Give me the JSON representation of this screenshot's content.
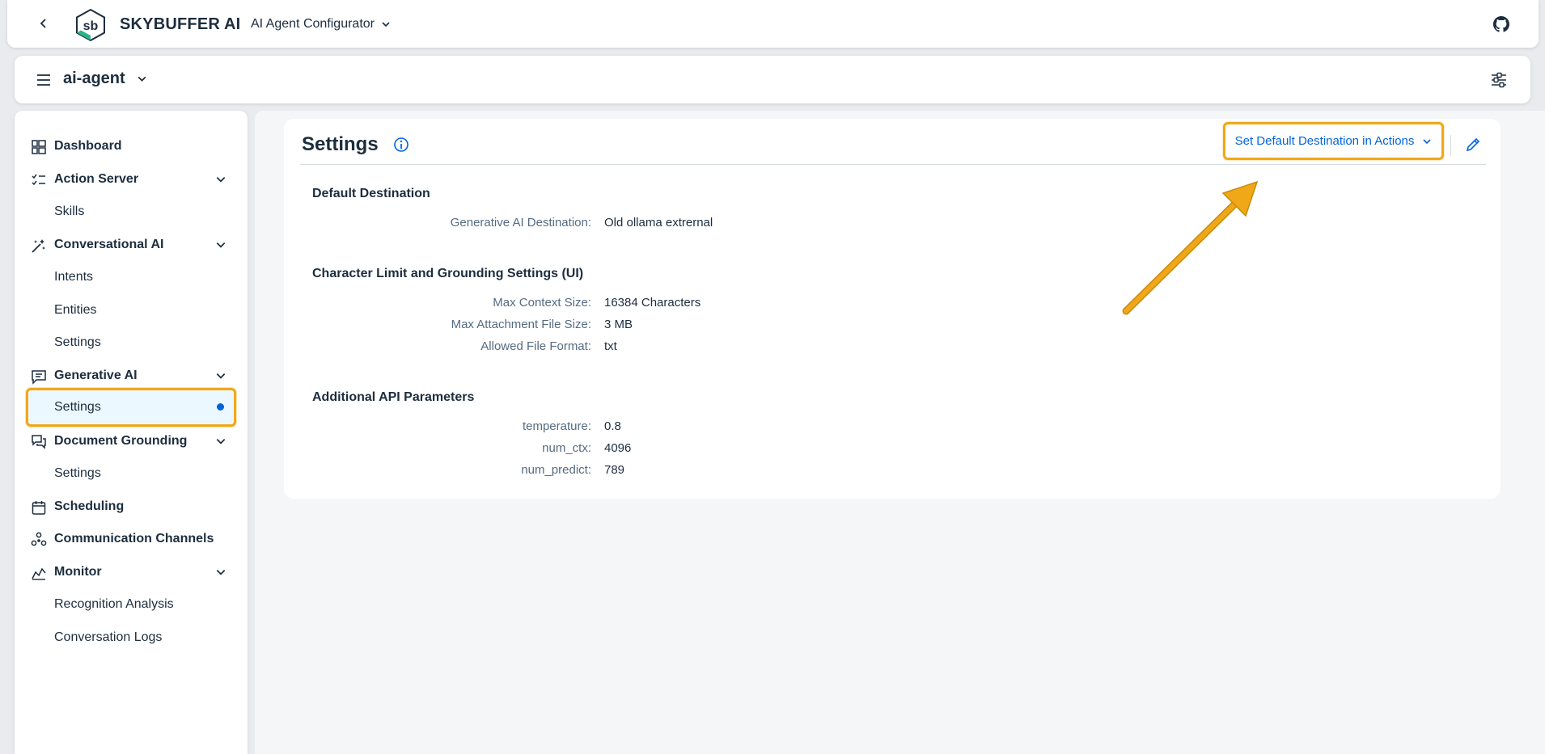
{
  "shell": {
    "brand": "SKYBUFFER AI",
    "product": "AI Agent Configurator"
  },
  "workspace": {
    "name": "ai-agent"
  },
  "sidebar": {
    "items": [
      {
        "label": "Dashboard"
      },
      {
        "label": "Action Server"
      },
      {
        "label": "Skills"
      },
      {
        "label": "Conversational AI"
      },
      {
        "label": "Intents"
      },
      {
        "label": "Entities"
      },
      {
        "label": "Settings"
      },
      {
        "label": "Generative AI"
      },
      {
        "label": "Settings"
      },
      {
        "label": "Document Grounding"
      },
      {
        "label": "Settings"
      },
      {
        "label": "Scheduling"
      },
      {
        "label": "Communication Channels"
      },
      {
        "label": "Monitor"
      },
      {
        "label": "Recognition Analysis"
      },
      {
        "label": "Conversation Logs"
      }
    ]
  },
  "page": {
    "title": "Settings",
    "destination_button": "Set Default Destination in Actions",
    "sections": [
      {
        "title": "Default Destination",
        "fields": [
          {
            "label": "Generative AI Destination:",
            "value": "Old ollama extrernal"
          }
        ]
      },
      {
        "title": "Character Limit and Grounding Settings (UI)",
        "fields": [
          {
            "label": "Max Context Size:",
            "value": "16384 Characters"
          },
          {
            "label": "Max Attachment File Size:",
            "value": "3 MB"
          },
          {
            "label": "Allowed File Format:",
            "value": "txt"
          }
        ]
      },
      {
        "title": "Additional API Parameters",
        "fields": [
          {
            "label": "temperature:",
            "value": "0.8"
          },
          {
            "label": "num_ctx:",
            "value": "4096"
          },
          {
            "label": "num_predict:",
            "value": "789"
          }
        ]
      }
    ]
  },
  "colors": {
    "accent": "#0064d9",
    "highlight": "#f0a818",
    "selected_bg": "#ebf8ff"
  }
}
